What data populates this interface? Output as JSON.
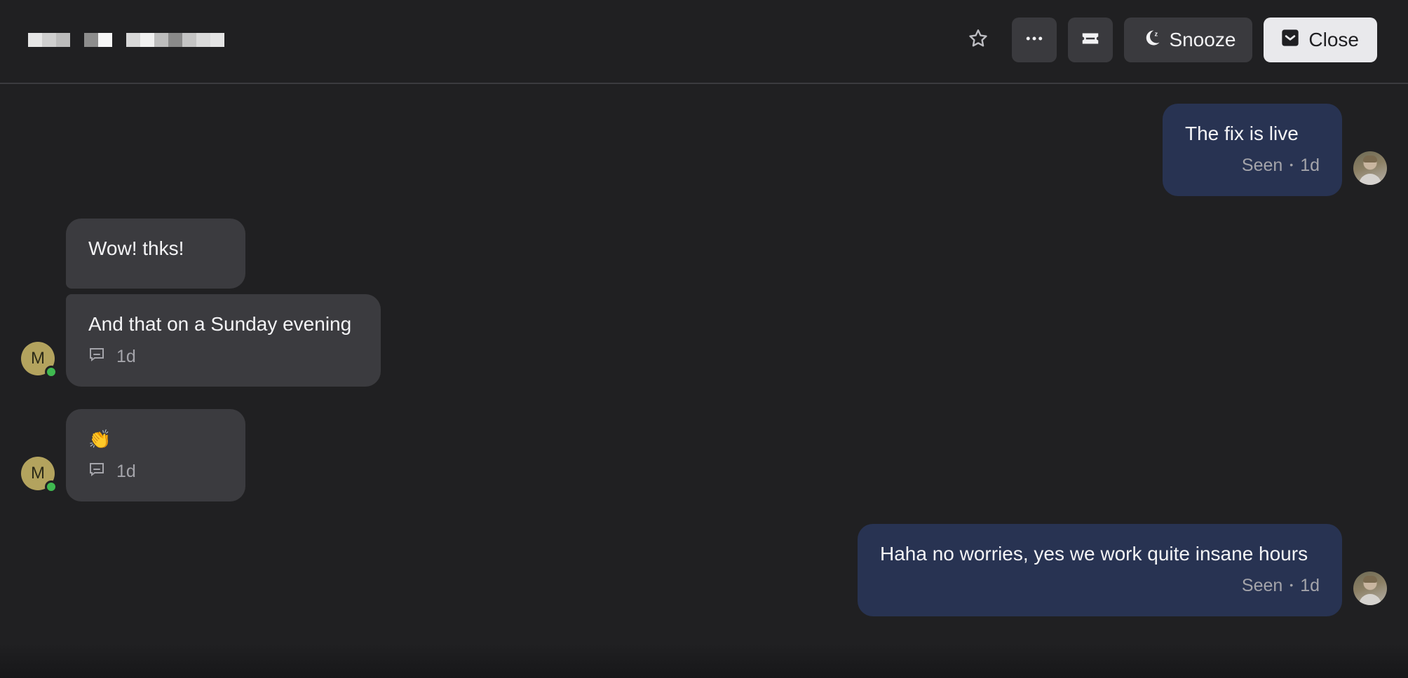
{
  "header": {
    "snooze_label": "Snooze",
    "close_label": "Close",
    "icons": {
      "star": "star-icon",
      "more": "more-horizontal-icon",
      "ticket": "ticket-icon",
      "snooze": "moon-snooze-icon",
      "close": "inbox-check-icon"
    }
  },
  "messages": [
    {
      "id": "m1",
      "side": "agent",
      "text": "The fix is live",
      "status": "Seen",
      "time": "1d"
    },
    {
      "id": "m2",
      "side": "user",
      "text": "Wow! thks!"
    },
    {
      "id": "m3",
      "side": "user",
      "text": "And that on a Sunday evening",
      "time": "1d",
      "avatar_initial": "M"
    },
    {
      "id": "m4",
      "side": "user",
      "text": "👏",
      "time": "1d",
      "avatar_initial": "M"
    },
    {
      "id": "m5",
      "side": "agent",
      "text": "Haha no worries, yes we work quite insane hours",
      "status": "Seen",
      "time": "1d"
    }
  ],
  "colors": {
    "background": "#202022",
    "agent_bubble": "#283352",
    "user_bubble": "#3b3b3f",
    "online": "#3fb950",
    "avatar_m": "#b3a35e"
  }
}
